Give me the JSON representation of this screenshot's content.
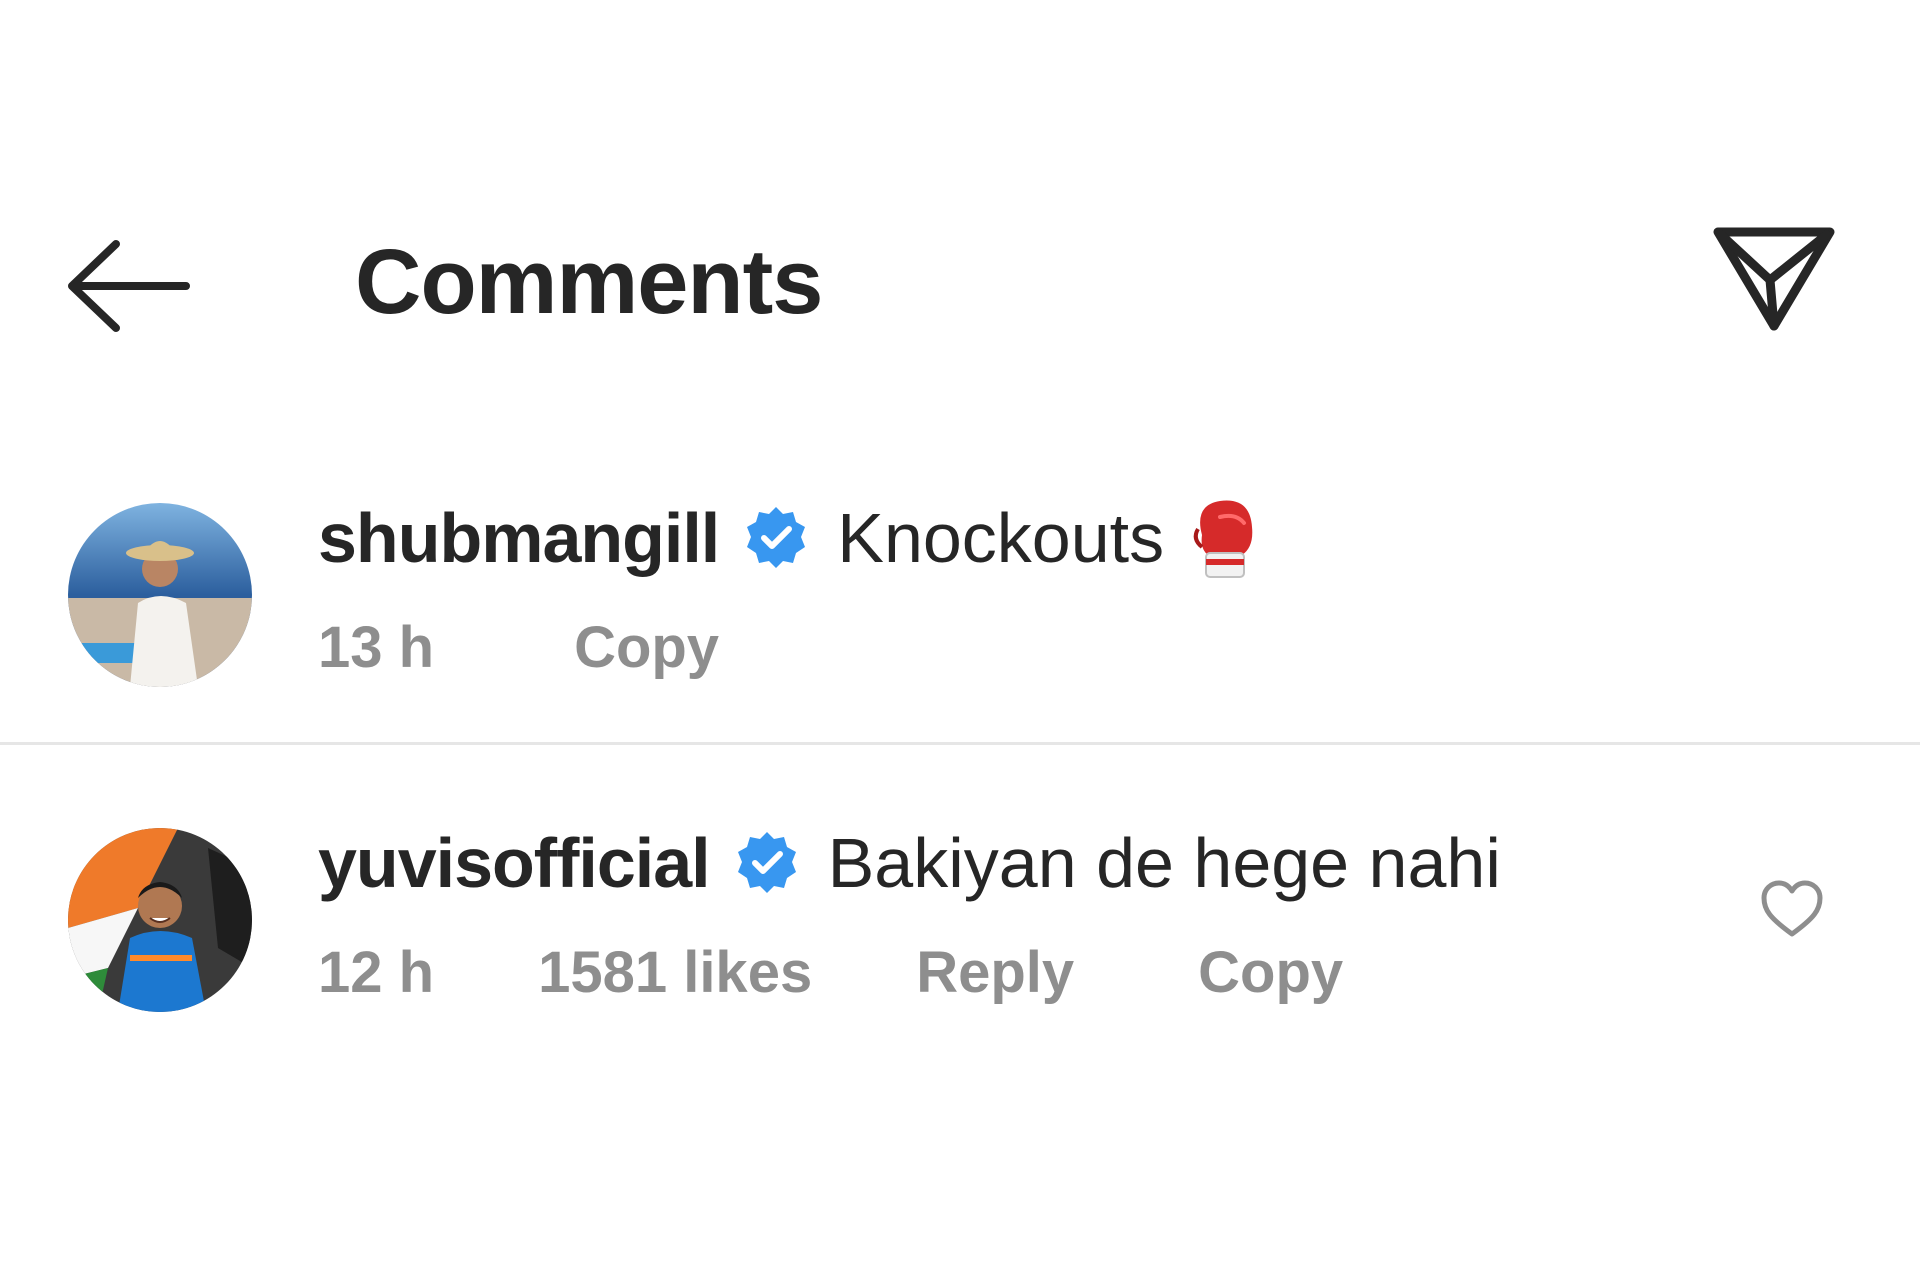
{
  "header": {
    "title": "Comments",
    "back_icon": "arrow-left-icon",
    "share_icon": "paper-plane-icon"
  },
  "comments": [
    {
      "username": "shubmangill",
      "verified": true,
      "text": "Knockouts",
      "emoji_icon": "boxing-glove-icon",
      "time": "13 h",
      "copy_label": "Copy"
    },
    {
      "username": "yuvisofficial",
      "verified": true,
      "text": "Bakiyan de hege nahi",
      "time": "12 h",
      "likes": "1581 likes",
      "reply_label": "Reply",
      "copy_label": "Copy",
      "like_icon": "heart-outline-icon"
    }
  ],
  "colors": {
    "text_primary": "#262626",
    "text_secondary": "#8e8e8e",
    "verified_blue": "#3897f0",
    "divider": "#e6e6e6"
  }
}
